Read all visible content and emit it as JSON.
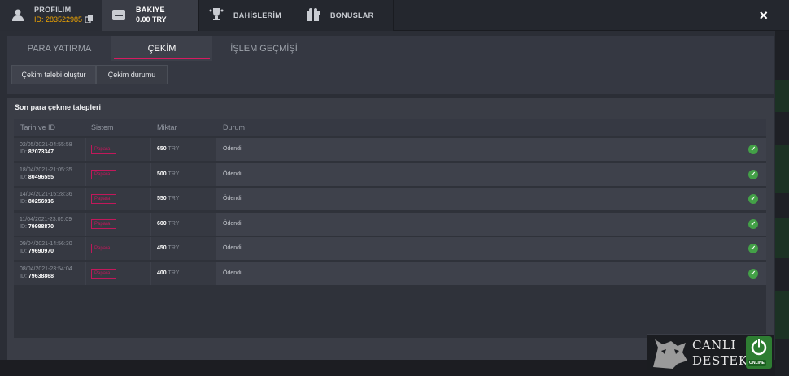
{
  "nav": {
    "profile_label": "PROFİLİM",
    "profile_id": "ID: 283522985",
    "balance_label": "BAKİYE",
    "balance_value": "0.00 TRY",
    "bets_label": "BAHİSLERİM",
    "bonus_label": "BONUSLAR",
    "close_label": "×"
  },
  "tabs": [
    "PARA YATIRMA",
    "ÇEKİM",
    "İŞLEM GEÇMİŞİ"
  ],
  "subtabs": [
    "Çekim talebi oluştur",
    "Çekim durumu"
  ],
  "section_title": "Son para çekme talepleri",
  "columns": [
    "Tarih ve ID",
    "Sistem",
    "Miktar",
    "Durum"
  ],
  "rows": [
    {
      "date": "02/05/2021-04:55:58",
      "id_label": "ID:",
      "id": "82073347",
      "system": "Papara",
      "amount": "650",
      "currency": "TRY",
      "status": "Ödendi"
    },
    {
      "date": "18/04/2021-21:05:35",
      "id_label": "ID:",
      "id": "80496555",
      "system": "Papara",
      "amount": "500",
      "currency": "TRY",
      "status": "Ödendi"
    },
    {
      "date": "14/04/2021-15:28:36",
      "id_label": "ID:",
      "id": "80256916",
      "system": "Papara",
      "amount": "550",
      "currency": "TRY",
      "status": "Ödendi"
    },
    {
      "date": "11/04/2021-23:05:09",
      "id_label": "ID:",
      "id": "79988870",
      "system": "Papara",
      "amount": "600",
      "currency": "TRY",
      "status": "Ödendi"
    },
    {
      "date": "09/04/2021-14:56:30",
      "id_label": "ID:",
      "id": "79690970",
      "system": "Papara",
      "amount": "450",
      "currency": "TRY",
      "status": "Ödendi"
    },
    {
      "date": "08/04/2021-23:54:04",
      "id_label": "ID:",
      "id": "79638868",
      "system": "Papara",
      "amount": "400",
      "currency": "TRY",
      "status": "Ödendi"
    }
  ],
  "support": {
    "line1": "CANLI",
    "line2": "DESTEK",
    "badge": "ONLINE"
  },
  "colors": {
    "accent": "#d81b60",
    "success": "#43a047"
  }
}
